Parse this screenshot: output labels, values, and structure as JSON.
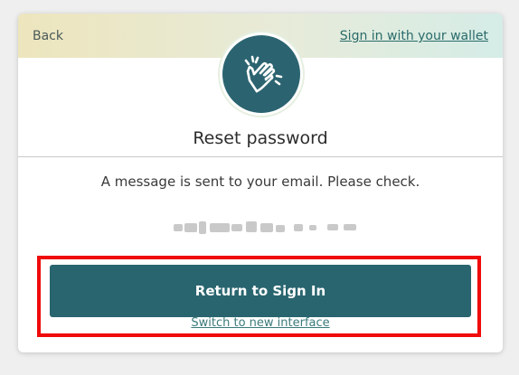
{
  "header": {
    "back_label": "Back",
    "wallet_link_label": "Sign in with your wallet"
  },
  "icon": {
    "name": "clapping-hands-icon",
    "background_color": "#2b6470"
  },
  "main": {
    "title": "Reset password",
    "message": "A message is sent to your email. Please check."
  },
  "actions": {
    "primary_label": "Return to Sign In",
    "switch_label": "Switch to new interface"
  },
  "colors": {
    "primary": "#29656f",
    "link": "#2a6b6a",
    "highlight_border": "#f00a0a"
  }
}
